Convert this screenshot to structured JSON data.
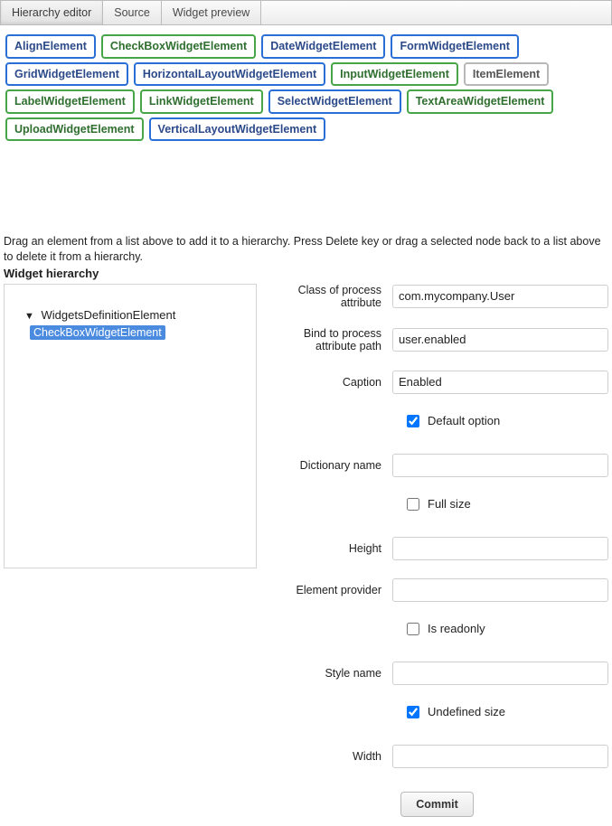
{
  "tabs": [
    {
      "label": "Hierarchy editor",
      "active": true
    },
    {
      "label": "Source",
      "active": false
    },
    {
      "label": "Widget preview",
      "active": false
    }
  ],
  "palette": [
    {
      "label": "AlignElement",
      "color": "blue"
    },
    {
      "label": "CheckBoxWidgetElement",
      "color": "green"
    },
    {
      "label": "DateWidgetElement",
      "color": "blue"
    },
    {
      "label": "FormWidgetElement",
      "color": "blue"
    },
    {
      "label": "GridWidgetElement",
      "color": "blue"
    },
    {
      "label": "HorizontalLayoutWidgetElement",
      "color": "blue"
    },
    {
      "label": "InputWidgetElement",
      "color": "green"
    },
    {
      "label": "ItemElement",
      "color": "gray"
    },
    {
      "label": "LabelWidgetElement",
      "color": "green"
    },
    {
      "label": "LinkWidgetElement",
      "color": "green"
    },
    {
      "label": "SelectWidgetElement",
      "color": "blue"
    },
    {
      "label": "TextAreaWidgetElement",
      "color": "green"
    },
    {
      "label": "UploadWidgetElement",
      "color": "green"
    },
    {
      "label": "VerticalLayoutWidgetElement",
      "color": "blue"
    }
  ],
  "instructions": "Drag an element from a list above to add it to a hierarchy. Press Delete key or drag a selected node back to a list above to delete it from a hierarchy.",
  "hierarchy": {
    "title": "Widget hierarchy",
    "root": "WidgetsDefinitionElement",
    "selected_child": "CheckBoxWidgetElement"
  },
  "form": {
    "class_of_process_attribute": {
      "label": "Class of process attribute",
      "value": "com.mycompany.User"
    },
    "bind_path": {
      "label": "Bind to process attribute path",
      "value": "user.enabled"
    },
    "caption": {
      "label": "Caption",
      "value": "Enabled"
    },
    "default_option": {
      "label": "Default option",
      "checked": true
    },
    "dictionary_name": {
      "label": "Dictionary name",
      "value": ""
    },
    "full_size": {
      "label": "Full size",
      "checked": false
    },
    "height": {
      "label": "Height",
      "value": ""
    },
    "element_provider": {
      "label": "Element provider",
      "value": ""
    },
    "is_readonly": {
      "label": "Is readonly",
      "checked": false
    },
    "style_name": {
      "label": "Style name",
      "value": ""
    },
    "undefined_size": {
      "label": "Undefined size",
      "checked": true
    },
    "width": {
      "label": "Width",
      "value": ""
    }
  },
  "commit_label": "Commit"
}
